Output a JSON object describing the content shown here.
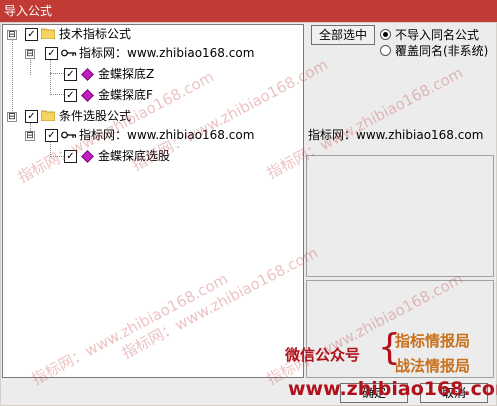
{
  "window": {
    "title": "导入公式"
  },
  "tree": {
    "groups": [
      {
        "label": "技术指标公式",
        "expander": "⊟",
        "site": "指标网：www.zhibiao168.com",
        "items": [
          "金蝶探底Z",
          "金蝶探底F"
        ]
      },
      {
        "label": "条件选股公式",
        "expander": "⊟",
        "site": "指标网：www.zhibiao168.com",
        "items": [
          "金蝶探底选股"
        ]
      }
    ],
    "check_mark": "✓"
  },
  "right": {
    "select_all_label": "全部选中",
    "radio_options": [
      {
        "label": "不导入同名公式",
        "selected": true
      },
      {
        "label": "覆盖同名(非系统)",
        "selected": false
      }
    ],
    "info_text": "指标网：www.zhibiao168.com"
  },
  "watermark": {
    "text": "指标网：www.zhibiao168.com",
    "wechat_label": "微信公众号",
    "accounts": [
      "指标情报局",
      "战法情报局"
    ],
    "url": "www.zhibiao168.com"
  },
  "buttons": {
    "ok_label": "确定",
    "cancel_label": "取消"
  },
  "colors": {
    "titlebar": "#c13b35",
    "accent_red": "#b0111a",
    "accent_orange": "#c8701a"
  }
}
